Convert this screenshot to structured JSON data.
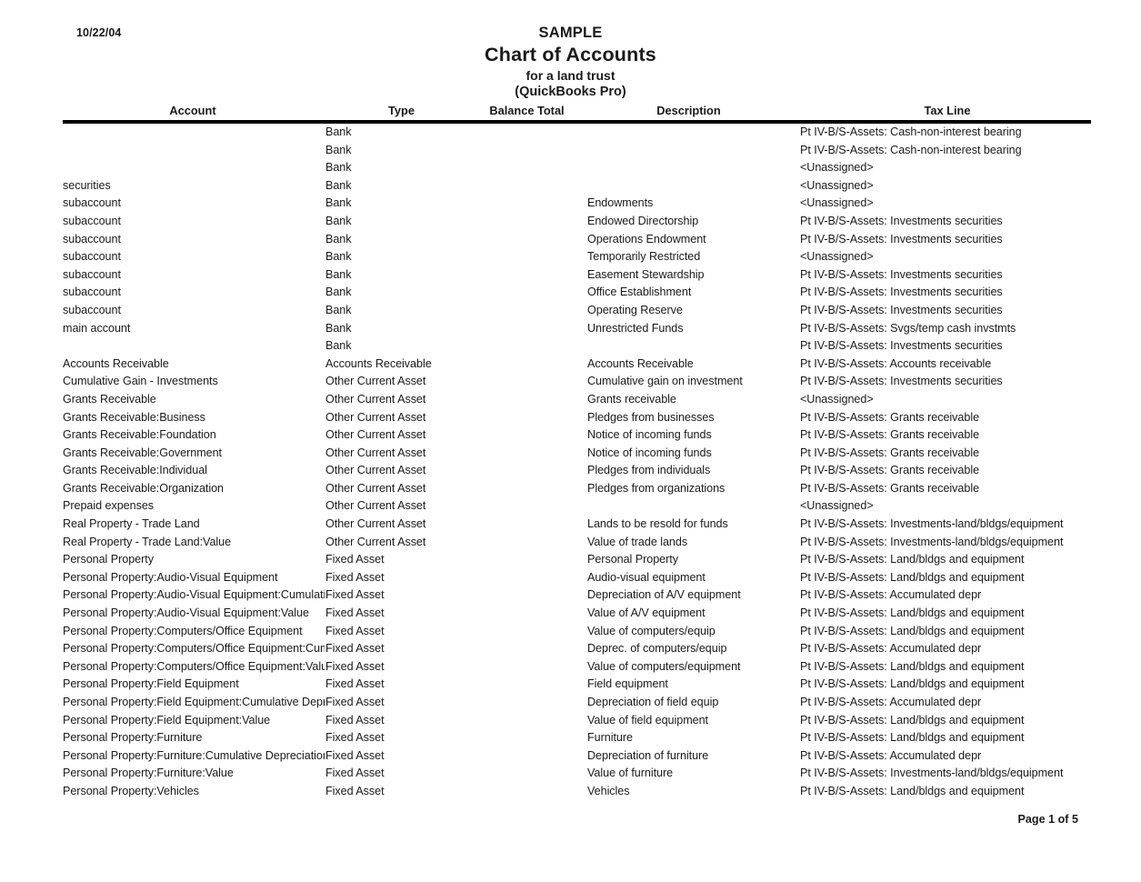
{
  "report": {
    "date": "10/22/04",
    "title_sample": "SAMPLE",
    "title_main": "Chart of Accounts",
    "title_sub1": "for a land trust",
    "title_sub2": "(QuickBooks Pro)",
    "footer_page": "Page 1 of 5"
  },
  "columns": {
    "account": "Account",
    "type": "Type",
    "balance_total": "Balance Total",
    "description": "Description",
    "tax_line": "Tax Line"
  },
  "rows": [
    {
      "account": "",
      "type": "Bank",
      "balance": "",
      "description": "",
      "tax_line": "Pt IV-B/S-Assets: Cash-non-interest bearing"
    },
    {
      "account": "",
      "type": "Bank",
      "balance": "",
      "description": "",
      "tax_line": "Pt IV-B/S-Assets: Cash-non-interest bearing"
    },
    {
      "account": "",
      "type": "Bank",
      "balance": "",
      "description": "",
      "tax_line": "<Unassigned>"
    },
    {
      "account": "securities",
      "type": "Bank",
      "balance": "",
      "description": "",
      "tax_line": "<Unassigned>"
    },
    {
      "account": "subaccount",
      "type": "Bank",
      "balance": "",
      "description": "Endowments",
      "tax_line": "<Unassigned>"
    },
    {
      "account": "subaccount",
      "type": "Bank",
      "balance": "",
      "description": "Endowed Directorship",
      "tax_line": "Pt IV-B/S-Assets: Investments securities"
    },
    {
      "account": "subaccount",
      "type": "Bank",
      "balance": "",
      "description": "Operations Endowment",
      "tax_line": "Pt IV-B/S-Assets: Investments securities"
    },
    {
      "account": "subaccount",
      "type": "Bank",
      "balance": "",
      "description": "Temporarily Restricted",
      "tax_line": "<Unassigned>"
    },
    {
      "account": "subaccount",
      "type": "Bank",
      "balance": "",
      "description": "Easement Stewardship",
      "tax_line": "Pt IV-B/S-Assets: Investments securities"
    },
    {
      "account": "subaccount",
      "type": "Bank",
      "balance": "",
      "description": "Office Establishment",
      "tax_line": "Pt IV-B/S-Assets: Investments securities"
    },
    {
      "account": "subaccount",
      "type": "Bank",
      "balance": "",
      "description": "Operating Reserve",
      "tax_line": "Pt IV-B/S-Assets: Investments securities"
    },
    {
      "account": "main account",
      "type": "Bank",
      "balance": "",
      "description": "Unrestricted Funds",
      "tax_line": "Pt IV-B/S-Assets: Svgs/temp cash invstmts"
    },
    {
      "account": "",
      "type": "Bank",
      "balance": "",
      "description": "",
      "tax_line": "Pt IV-B/S-Assets: Investments securities"
    },
    {
      "account": "Accounts Receivable",
      "type": "Accounts Receivable",
      "balance": "",
      "description": "Accounts Receivable",
      "tax_line": "Pt IV-B/S-Assets: Accounts receivable"
    },
    {
      "account": "Cumulative Gain - Investments",
      "type": "Other Current Asset",
      "balance": "",
      "description": "Cumulative gain on investment",
      "tax_line": "Pt IV-B/S-Assets: Investments securities"
    },
    {
      "account": "Grants Receivable",
      "type": "Other Current Asset",
      "balance": "",
      "description": "Grants receivable",
      "tax_line": "<Unassigned>"
    },
    {
      "account": "Grants Receivable:Business",
      "type": "Other Current Asset",
      "balance": "",
      "description": "Pledges from businesses",
      "tax_line": "Pt IV-B/S-Assets: Grants receivable"
    },
    {
      "account": "Grants Receivable:Foundation",
      "type": "Other Current Asset",
      "balance": "",
      "description": "Notice of incoming funds",
      "tax_line": "Pt IV-B/S-Assets: Grants receivable"
    },
    {
      "account": "Grants Receivable:Government",
      "type": "Other Current Asset",
      "balance": "",
      "description": "Notice of incoming funds",
      "tax_line": "Pt IV-B/S-Assets: Grants receivable"
    },
    {
      "account": "Grants Receivable:Individual",
      "type": "Other Current Asset",
      "balance": "",
      "description": "Pledges from individuals",
      "tax_line": "Pt IV-B/S-Assets: Grants receivable"
    },
    {
      "account": "Grants Receivable:Organization",
      "type": "Other Current Asset",
      "balance": "",
      "description": "Pledges from organizations",
      "tax_line": "Pt IV-B/S-Assets: Grants receivable"
    },
    {
      "account": "Prepaid expenses",
      "type": "Other Current Asset",
      "balance": "",
      "description": "",
      "tax_line": "<Unassigned>"
    },
    {
      "account": "Real Property - Trade Land",
      "type": "Other Current Asset",
      "balance": "",
      "description": "Lands to be resold for funds",
      "tax_line": "Pt IV-B/S-Assets: Investments-land/bldgs/equipment"
    },
    {
      "account": "Real Property - Trade Land:Value",
      "type": "Other Current Asset",
      "balance": "",
      "description": "Value of trade lands",
      "tax_line": "Pt IV-B/S-Assets: Investments-land/bldgs/equipment"
    },
    {
      "account": "Personal Property",
      "type": "Fixed Asset",
      "balance": "",
      "description": "Personal Property",
      "tax_line": "Pt IV-B/S-Assets: Land/bldgs and equipment"
    },
    {
      "account": "Personal Property:Audio-Visual Equipment",
      "type": "Fixed Asset",
      "balance": "",
      "description": "Audio-visual equipment",
      "tax_line": "Pt IV-B/S-Assets: Land/bldgs and equipment"
    },
    {
      "account": "Personal Property:Audio-Visual Equipment:Cumulative Depreciation",
      "type": "Fixed Asset",
      "balance": "",
      "description": "Depreciation of A/V equipment",
      "tax_line": "Pt IV-B/S-Assets: Accumulated depr"
    },
    {
      "account": "Personal Property:Audio-Visual Equipment:Value",
      "type": "Fixed Asset",
      "balance": "",
      "description": "Value of A/V equipment",
      "tax_line": "Pt IV-B/S-Assets: Land/bldgs and equipment"
    },
    {
      "account": "Personal Property:Computers/Office Equipment",
      "type": "Fixed Asset",
      "balance": "",
      "description": "Value of computers/equip",
      "tax_line": "Pt IV-B/S-Assets: Land/bldgs and equipment"
    },
    {
      "account": "Personal Property:Computers/Office Equipment:Cumulative Depreciation",
      "type": "Fixed Asset",
      "balance": "",
      "description": "Deprec. of computers/equip",
      "tax_line": "Pt IV-B/S-Assets: Accumulated depr"
    },
    {
      "account": "Personal Property:Computers/Office Equipment:Value",
      "type": "Fixed Asset",
      "balance": "",
      "description": "Value of computers/equipment",
      "tax_line": "Pt IV-B/S-Assets: Land/bldgs and equipment"
    },
    {
      "account": "Personal Property:Field Equipment",
      "type": "Fixed Asset",
      "balance": "",
      "description": "Field equipment",
      "tax_line": "Pt IV-B/S-Assets: Land/bldgs and equipment"
    },
    {
      "account": "Personal Property:Field Equipment:Cumulative Depreciation",
      "type": "Fixed Asset",
      "balance": "",
      "description": "Depreciation of field equip",
      "tax_line": "Pt IV-B/S-Assets: Accumulated depr"
    },
    {
      "account": "Personal Property:Field Equipment:Value",
      "type": "Fixed Asset",
      "balance": "",
      "description": "Value of field equipment",
      "tax_line": "Pt IV-B/S-Assets: Land/bldgs and equipment"
    },
    {
      "account": "Personal Property:Furniture",
      "type": "Fixed Asset",
      "balance": "",
      "description": "Furniture",
      "tax_line": "Pt IV-B/S-Assets: Land/bldgs and equipment"
    },
    {
      "account": "Personal Property:Furniture:Cumulative Depreciation",
      "type": "Fixed Asset",
      "balance": "",
      "description": "Depreciation of furniture",
      "tax_line": "Pt IV-B/S-Assets: Accumulated depr"
    },
    {
      "account": "Personal Property:Furniture:Value",
      "type": "Fixed Asset",
      "balance": "",
      "description": "Value of furniture",
      "tax_line": "Pt IV-B/S-Assets: Investments-land/bldgs/equipment"
    },
    {
      "account": "Personal Property:Vehicles",
      "type": "Fixed Asset",
      "balance": "",
      "description": "Vehicles",
      "tax_line": "Pt IV-B/S-Assets: Land/bldgs and equipment"
    }
  ]
}
